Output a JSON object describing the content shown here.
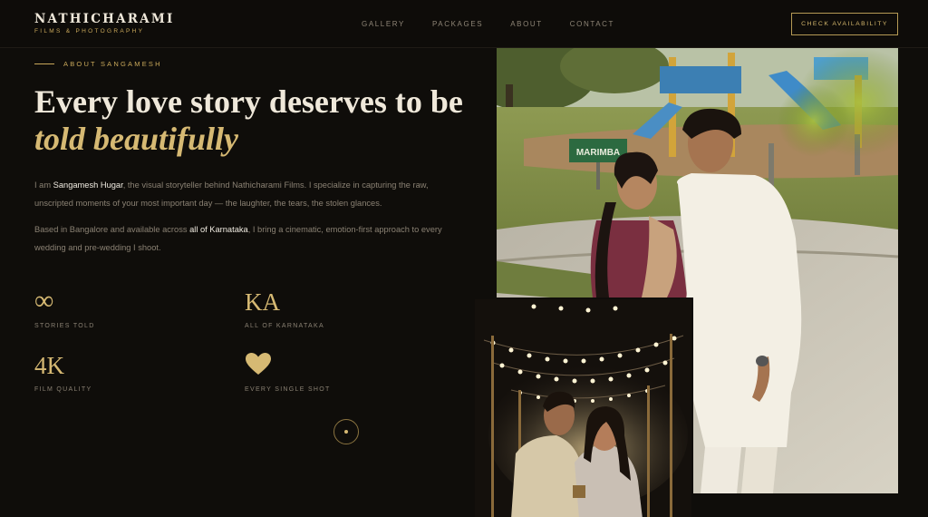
{
  "brand": {
    "name": "NATHICHARAMI",
    "tagline": "FILMS & PHOTOGRAPHY"
  },
  "nav": {
    "items": [
      "GALLERY",
      "PACKAGES",
      "ABOUT",
      "CONTACT"
    ],
    "cta": "CHECK AVAILABILITY"
  },
  "about": {
    "eyebrow": "ABOUT SANGAMESH",
    "headline_line1": "Every love story deserves to be",
    "headline_line2": "told beautifully",
    "p1_pre": "I am ",
    "p1_name": "Sangamesh Hugar",
    "p1_post": ", the visual storyteller behind Nathicharami Films. I specialize in capturing the raw, unscripted moments of your most important day — the laughter, the tears, the stolen glances.",
    "p2_pre": "Based in Bangalore and available across ",
    "p2_highlight": "all of Karnataka",
    "p2_post": ", I bring a cinematic, emotion-first approach to every wedding and pre-wedding I shoot."
  },
  "stats": [
    {
      "value": "∞",
      "label": "STORIES TOLD"
    },
    {
      "value": "KA",
      "label": "ALL OF KARNATAKA"
    },
    {
      "value": "4K",
      "label": "FILM QUALITY"
    },
    {
      "value": "",
      "label": "EVERY SINGLE SHOT"
    }
  ],
  "photo_main": {
    "sign_text": "MARIMBA"
  },
  "colors": {
    "accent": "#d6b973",
    "background": "#0f0d0a",
    "text": "#efe8da",
    "muted": "#8a8173"
  },
  "icons": {
    "stat4": "heart-icon",
    "scroll": "scroll-indicator-icon"
  }
}
